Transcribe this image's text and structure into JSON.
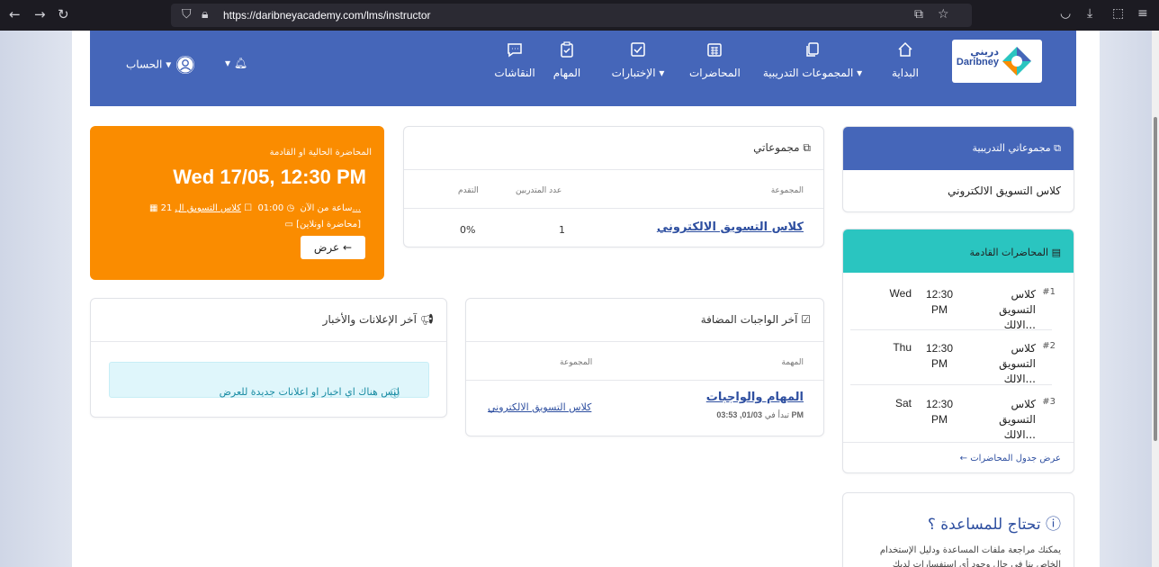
{
  "browser": {
    "url": "https://daribneyacademy.com/lms/instructor"
  },
  "brand": {
    "name_ar": "دريني",
    "name_en": "Daribney"
  },
  "nav": {
    "home": "البداية",
    "groups": "المجموعات التدريبية ▾",
    "lectures": "المحاضرات",
    "quizzes": "الإختبارات ▾",
    "tasks": "المهام",
    "discussions": "النقاشات",
    "account": "الحساب ▾",
    "bell_caret": "▾"
  },
  "current_lecture": {
    "label": "المحاضرة الحالية او القادمة",
    "datetime": "Wed 17/05, 12:30 PM",
    "when": "21 ساعة من الآن",
    "duration": "01:00",
    "group": "كلاس التسويق ال...",
    "type": "[محاضرة اونلاين]",
    "view_button": "عرض ←"
  },
  "my_groups": {
    "title": "مجموعاتي",
    "col_group": "المجموعة",
    "col_trainees": "عدد المتدربين",
    "col_progress": "التقدم",
    "rows": [
      {
        "name": "كلاس التسويق الالكتروني",
        "trainees": "1",
        "progress": "0%"
      }
    ]
  },
  "training_groups": {
    "title": "مجموعاتي التدريبية",
    "item": "كلاس التسويق الالكتروني"
  },
  "upcoming": {
    "title": "المحاضرات القادمة",
    "rows": [
      {
        "num": "#1",
        "name_1": "كلاس التسويق",
        "name_2": "الالك...",
        "time_1": "12:30",
        "time_2": "PM",
        "day": "Wed"
      },
      {
        "num": "#2",
        "name_1": "كلاس التسويق",
        "name_2": "الالك...",
        "time_1": "12:30",
        "time_2": "PM",
        "day": "Thu"
      },
      {
        "num": "#3",
        "name_1": "كلاس التسويق",
        "name_2": "الالك...",
        "time_1": "12:30",
        "time_2": "PM",
        "day": "Sat"
      }
    ],
    "footer_link": "← عرض جدول المحاضرات"
  },
  "assignments": {
    "title": "آخر الواجبات المضافة",
    "col_task": "المهمة",
    "col_group": "المجموعة",
    "task_name": "المهام والواجبات",
    "task_starts_prefix": "تبدأ في",
    "task_starts_date": "01/03, 03:53 PM",
    "group_link": "كلاس التسويق الالكتروني"
  },
  "news": {
    "title": "آخر الإعلانات والأخبار",
    "empty": "ليس هناك اي اخبار او اعلانات جديدة للعرض"
  },
  "help": {
    "title": "تحتاج للمساعدة ؟",
    "body": "يمكنك مراجعة ملفات المساعدة ودليل الإستخدام الخاص بنا في حال وجود أي إستفسارات لديك"
  },
  "colors": {
    "primary": "#4566b9",
    "orange": "#fa8c00",
    "teal": "#2ac5c0",
    "info_bg": "#dff6fb"
  },
  "icons": [
    "back-icon",
    "forward-icon",
    "reload-icon",
    "shield-icon",
    "lock-icon",
    "translate-icon",
    "star-icon",
    "pocket-icon",
    "download-icon",
    "extensions-icon",
    "menu-icon",
    "home-icon",
    "copy-icon",
    "calendar-grid-icon",
    "check-square-icon",
    "clipboard-check-icon",
    "chat-icon",
    "bell-icon",
    "user-icon",
    "calendar-icon",
    "clock-icon",
    "stop-icon",
    "video-icon",
    "megaphone-icon",
    "info-icon",
    "help-circle-icon"
  ]
}
